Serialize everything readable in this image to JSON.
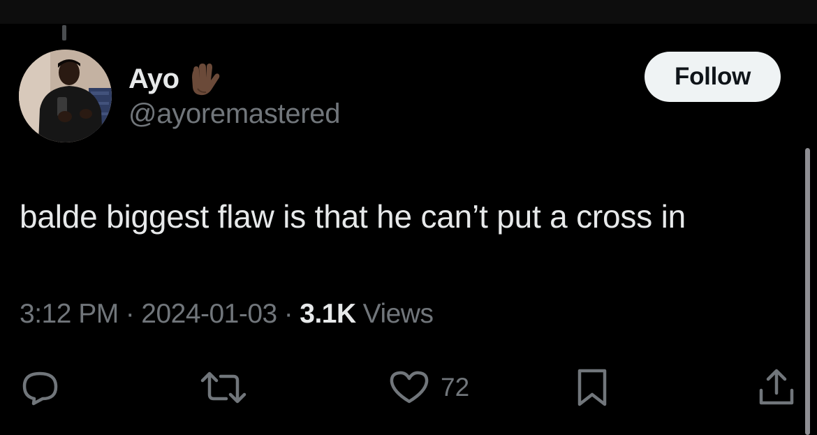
{
  "tweet": {
    "author": {
      "display_name": "Ayo",
      "handle": "@ayoremastered",
      "emoji_icon": "raised-back-of-hand-icon"
    },
    "follow_label": "Follow",
    "text": "balde biggest flaw is that he can’t put a cross in",
    "meta": {
      "time": "3:12 PM",
      "separator": "·",
      "date": "2024-01-03",
      "views_count": "3.1K",
      "views_label": "Views"
    },
    "actions": {
      "reply_icon": "reply-icon",
      "retweet_icon": "retweet-icon",
      "like_icon": "heart-icon",
      "like_count": "72",
      "bookmark_icon": "bookmark-icon",
      "share_icon": "share-icon"
    }
  },
  "colors": {
    "background": "#000000",
    "primary_text": "#e7e9ea",
    "secondary_text": "#71767b",
    "follow_bg": "#eff3f4",
    "follow_text": "#0f1419"
  }
}
